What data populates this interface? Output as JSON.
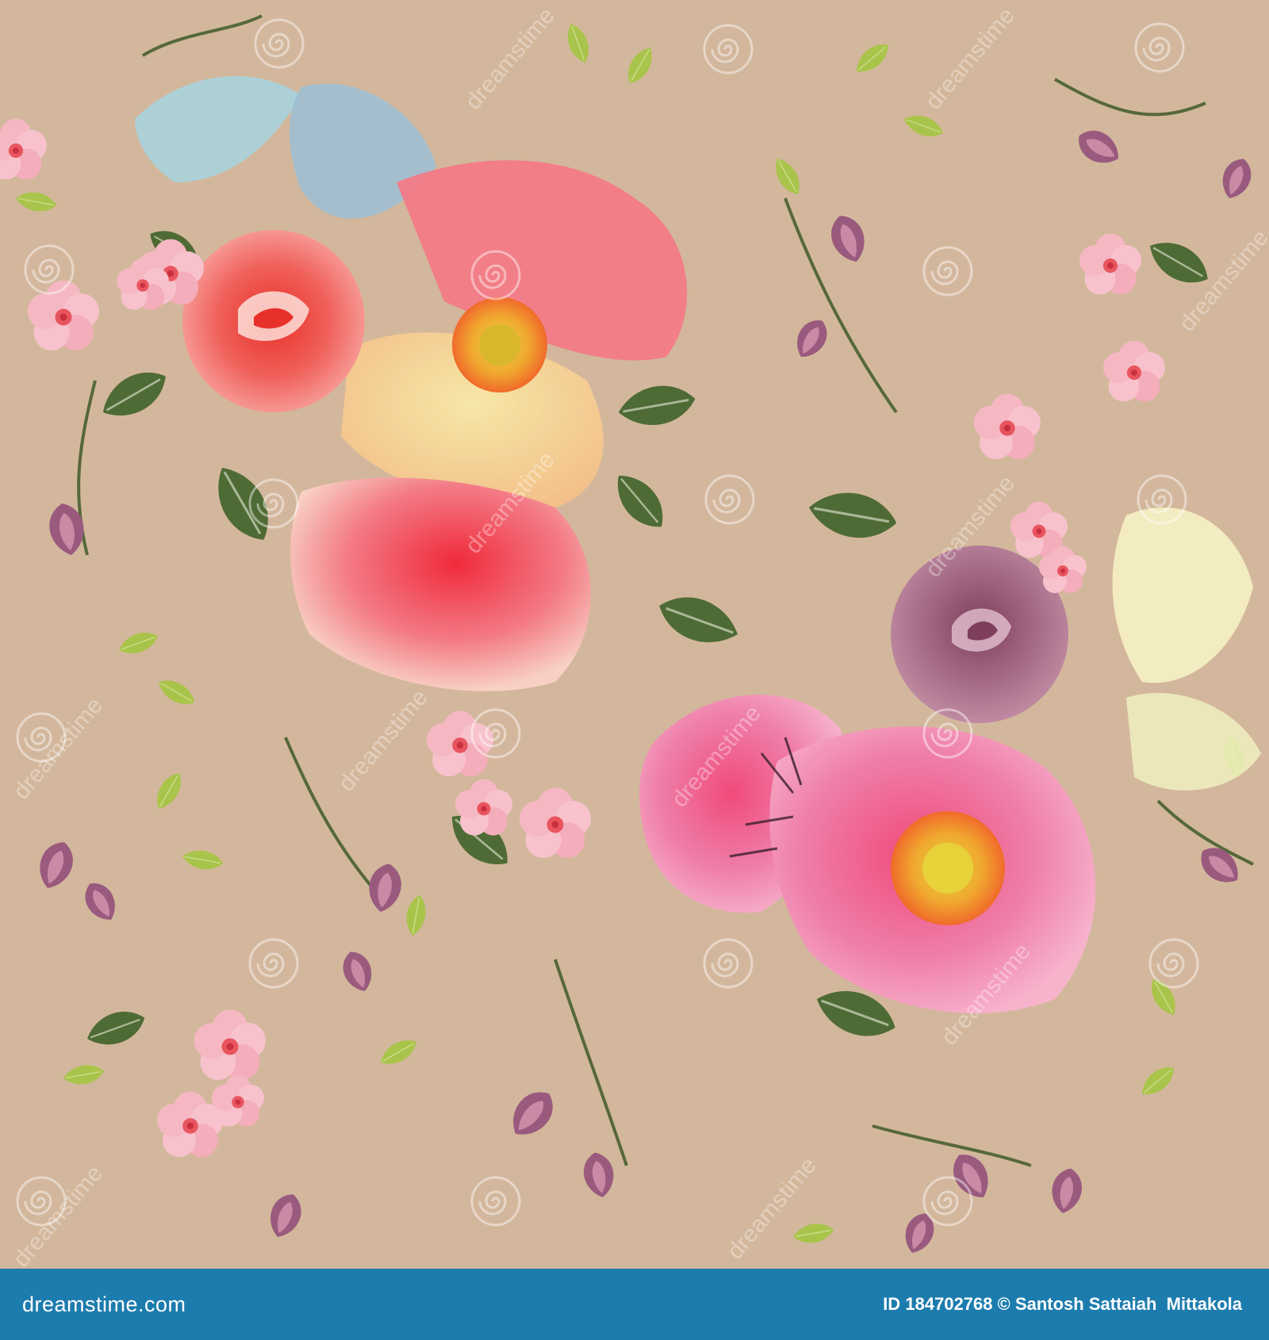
{
  "palette": {
    "background": "#d3b79c",
    "footer": "#1d7cae",
    "leaf_dark": "#4f6b35",
    "leaf_light": "#a9c44a",
    "rose_coral": "#f0605a",
    "rose_pink": "#ef7faa",
    "rose_mauve": "#9b5a78",
    "blossom_pink": "#f5b8c3",
    "bud_plum": "#9a5a7e",
    "pale_yellow": "#f6e7a6",
    "sky_blue": "#a9d3dd"
  },
  "watermark": {
    "icon": "spiral-watermark-icon",
    "text": "dreamstime"
  },
  "footer": {
    "brand": "dreamstime.com",
    "credit": "ID 184702768 © Santosh Sattaiah  Mittakola"
  }
}
